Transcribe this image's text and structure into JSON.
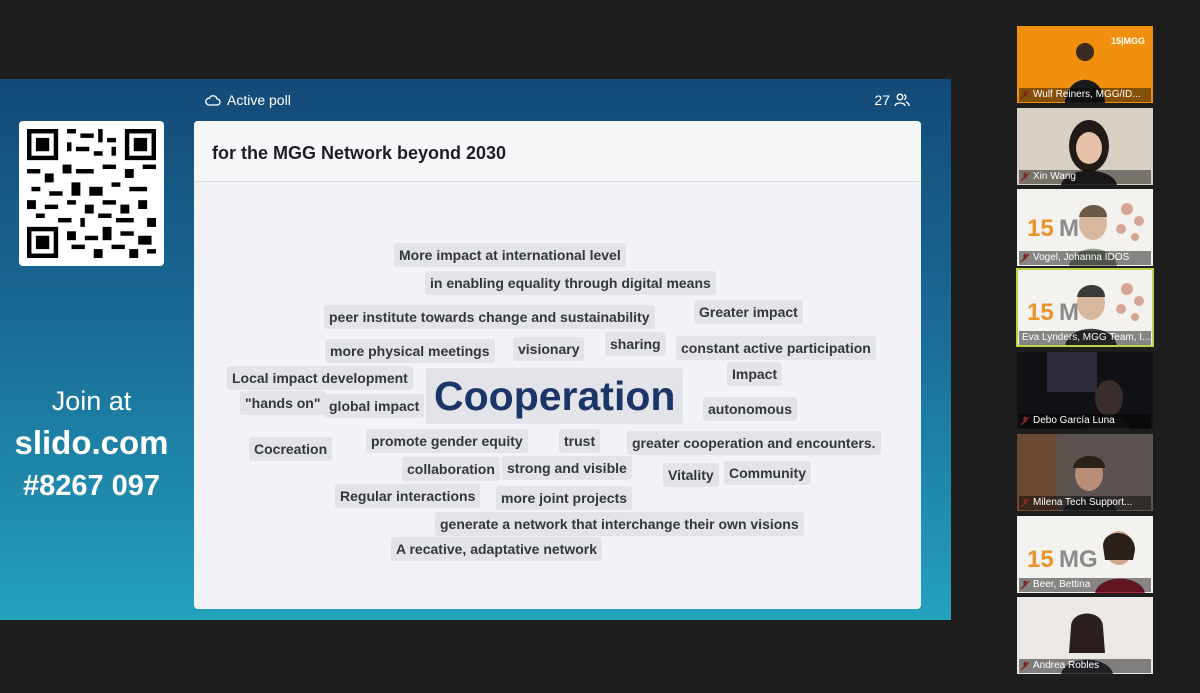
{
  "slide": {
    "join": {
      "line1": "Join at",
      "line2": "slido.com",
      "line3": "#8267 097"
    },
    "poll": {
      "status": "Active poll",
      "participants": "27",
      "question": "for the MGG Network beyond 2030"
    },
    "words": [
      "More impact at international level",
      "in enabling equality through digital means",
      "peer institute towards change and sustainability",
      "Greater impact",
      "more physical meetings",
      "visionary",
      "sharing",
      "constant active participation",
      "Local impact development",
      "Impact",
      "\"hands on\"",
      "global impact",
      "Cooperation",
      "autonomous",
      "Cocreation",
      "promote gender equity",
      "trust",
      "greater cooperation and encounters.",
      "collaboration",
      "strong and visible",
      "Vitality",
      "Community",
      "Regular interactions",
      "more joint projects",
      "generate a network that interchange their own visions",
      "A recative, adaptative network"
    ]
  },
  "participants": [
    {
      "name": "Wulf Reiners, MGG/ID...",
      "logo": "15|MGG"
    },
    {
      "name": "Xin Wang"
    },
    {
      "name": "Vogel, Johanna IDOS",
      "logo": "15",
      "logo2": "M"
    },
    {
      "name": "Eva Lynders, MGG Team, I...",
      "logo": "15",
      "logo2": "M",
      "active": true
    },
    {
      "name": "Debo García Luna"
    },
    {
      "name": "Milena Tech Support..."
    },
    {
      "name": "Beer, Bettina",
      "logo": "15",
      "logo2": "MG"
    },
    {
      "name": "Andrea Robles"
    }
  ],
  "colors": {
    "accent": "#b9d34a",
    "brand_orange": "#f0900e",
    "slide_top": "#144a78",
    "slide_bottom": "#24a2bd"
  }
}
